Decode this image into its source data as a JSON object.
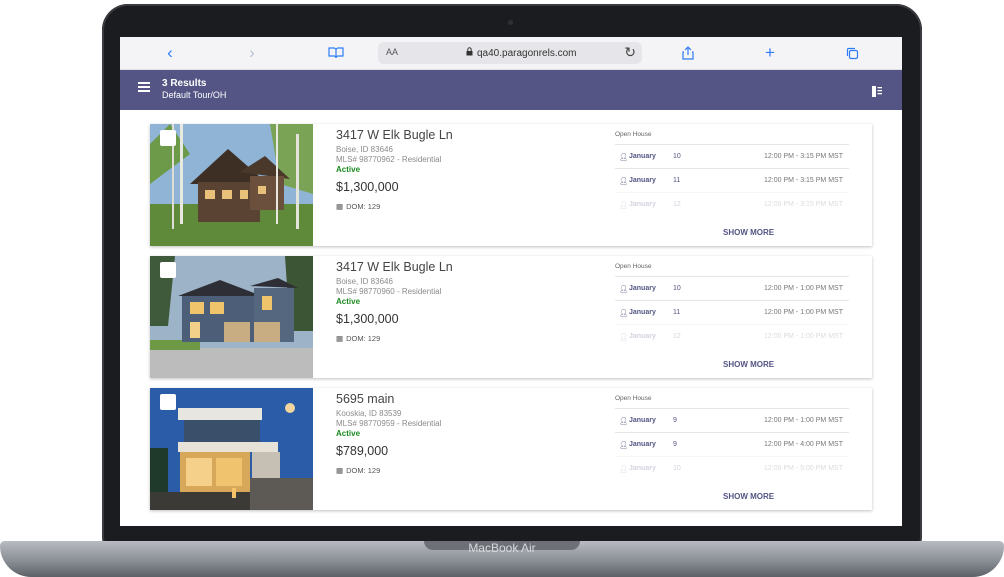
{
  "device": {
    "model": "MacBook Air"
  },
  "browser": {
    "back_icon": "chevron-left-icon",
    "forward_icon": "chevron-right-icon",
    "bookmarks_icon": "book-icon",
    "text_size": "AA",
    "url": "qa40.paragonrels.com",
    "reload_icon": "reload-icon",
    "share_icon": "share-icon",
    "new_tab_icon": "plus-icon",
    "tabs_icon": "tabs-icon"
  },
  "header": {
    "results": "3 Results",
    "subtitle": "Default Tour/OH",
    "accent": "#545584"
  },
  "listings": [
    {
      "address": "3417 W Elk Bugle Ln",
      "city": "Boise, ID 83646",
      "mls": "MLS# 98770962 - Residential",
      "status": "Active",
      "price": "$1,300,000",
      "dom": "DOM: 129",
      "open_house_label": "Open House",
      "open_houses": [
        {
          "month": "January",
          "day": "10",
          "time": "12:00 PM - 3:15 PM MST"
        },
        {
          "month": "January",
          "day": "11",
          "time": "12:00 PM - 3:15 PM MST"
        },
        {
          "month": "January",
          "day": "12",
          "time": "12:00 PM - 3:15 PM MST"
        }
      ],
      "show_more": "SHOW MORE"
    },
    {
      "address": "3417 W Elk Bugle Ln",
      "city": "Boise, ID 83646",
      "mls": "MLS# 98770960 - Residential",
      "status": "Active",
      "price": "$1,300,000",
      "dom": "DOM: 129",
      "open_house_label": "Open House",
      "open_houses": [
        {
          "month": "January",
          "day": "10",
          "time": "12:00 PM - 1:00 PM MST"
        },
        {
          "month": "January",
          "day": "11",
          "time": "12:00 PM - 1:00 PM MST"
        },
        {
          "month": "January",
          "day": "12",
          "time": "12:00 PM - 1:00 PM MST"
        }
      ],
      "show_more": "SHOW MORE"
    },
    {
      "address": "5695 main",
      "city": "Kooskia, ID 83539",
      "mls": "MLS# 98770959 - Residential",
      "status": "Active",
      "price": "$789,000",
      "dom": "DOM: 129",
      "open_house_label": "Open House",
      "open_houses": [
        {
          "month": "January",
          "day": "9",
          "time": "12:00 PM - 1:00 PM MST"
        },
        {
          "month": "January",
          "day": "9",
          "time": "12:00 PM - 4:00 PM MST"
        },
        {
          "month": "January",
          "day": "10",
          "time": "12:00 PM - 5:00 PM MST"
        }
      ],
      "show_more": "SHOW MORE"
    }
  ]
}
